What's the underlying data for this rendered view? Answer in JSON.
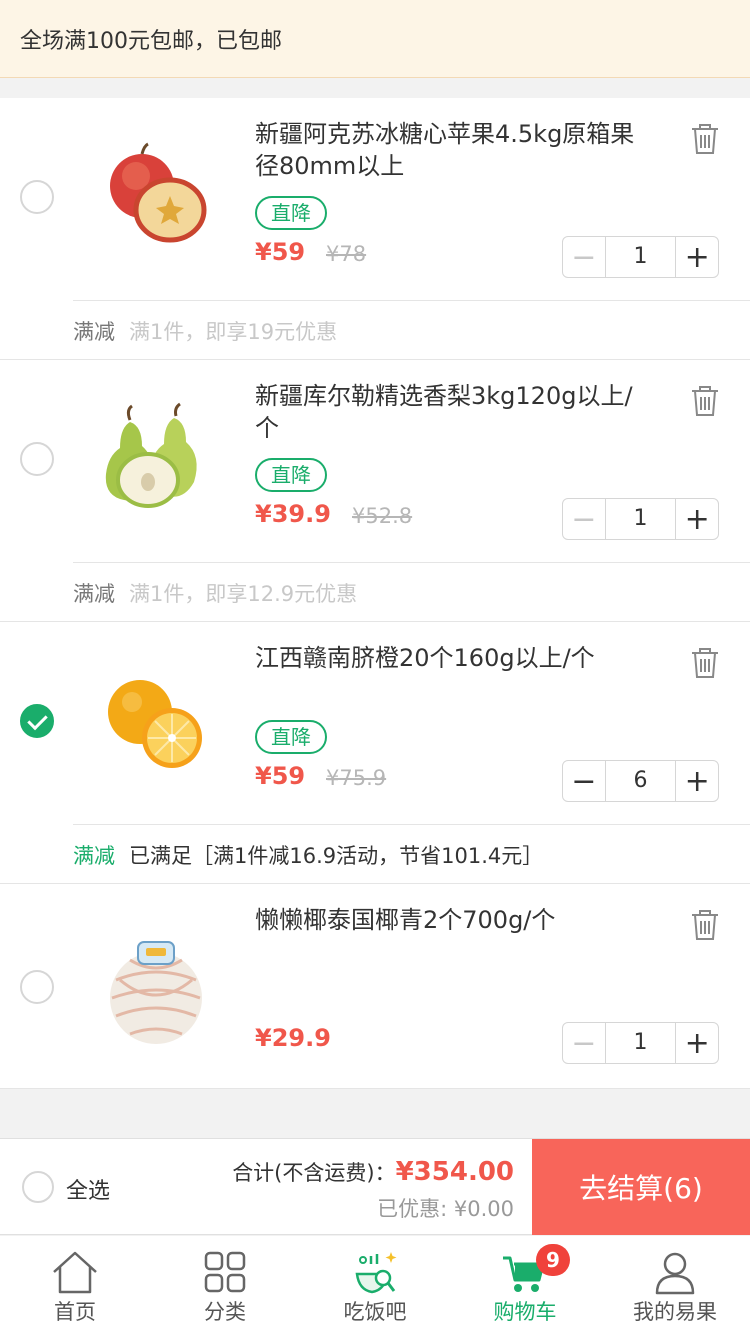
{
  "banner": {
    "text": "全场满100元包邮，已包邮"
  },
  "items": [
    {
      "title": "新疆阿克苏冰糖心苹果4.5kg原箱果径80mm以上",
      "tag": "直降",
      "price": "¥59",
      "orig_price": "¥78",
      "qty": "1",
      "checked": false,
      "image": "apple",
      "promo_label": "满减",
      "promo_text": "满1件，即享19元优惠"
    },
    {
      "title": "新疆库尔勒精选香梨3kg120g以上/个",
      "tag": "直降",
      "price": "¥39.9",
      "orig_price": "¥52.8",
      "qty": "1",
      "checked": false,
      "image": "pear",
      "promo_label": "满减",
      "promo_text": "满1件，即享12.9元优惠"
    },
    {
      "title": "江西赣南脐橙20个160g以上/个",
      "tag": "直降",
      "price": "¥59",
      "orig_price": "¥75.9",
      "qty": "6",
      "checked": true,
      "image": "orange",
      "promo_label": "满减",
      "promo_text": "已满足［满1件减16.9活动，节省101.4元］"
    },
    {
      "title": "懒懒椰泰国椰青2个700g/个",
      "price": "¥29.9",
      "qty": "1",
      "checked": false,
      "image": "coconut"
    }
  ],
  "checkout": {
    "select_all": "全选",
    "total_label": "合计(不含运费)：",
    "total_amount": "¥354.00",
    "discount": "已优惠: ¥0.00",
    "button": "去结算(6)"
  },
  "tabbar": {
    "tabs": [
      {
        "label": "首页",
        "icon": "home-icon"
      },
      {
        "label": "分类",
        "icon": "category-icon"
      },
      {
        "label": "吃饭吧",
        "icon": "dining-icon"
      },
      {
        "label": "购物车",
        "icon": "cart-icon",
        "active": true,
        "badge": "9"
      },
      {
        "label": "我的易果",
        "icon": "user-icon"
      }
    ]
  },
  "colors": {
    "accent_green": "#1aad6b",
    "price_red": "#f0574b",
    "checkout_red": "#f8655a",
    "banner_bg": "#fdf5e6"
  }
}
